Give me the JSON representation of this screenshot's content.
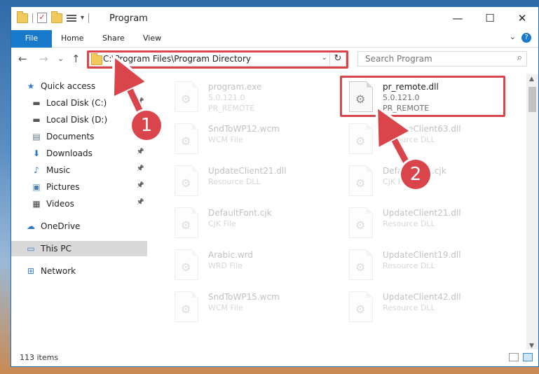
{
  "window": {
    "title": "Program",
    "controls": {
      "minimize": "—",
      "maximize": "☐",
      "close": "✕"
    }
  },
  "ribbon": {
    "tabs": [
      "File",
      "Home",
      "Share",
      "View"
    ],
    "help": "?"
  },
  "navigation": {
    "back": "←",
    "forward": "→",
    "recent": "⌄",
    "up": "↑",
    "address": "C:\\Program Files\\Program Directory",
    "refresh": "↻",
    "search_placeholder": "Search Program"
  },
  "sidebar": {
    "items": [
      {
        "label": "Quick access",
        "icon": "star-icon",
        "glyph": "★",
        "color": "#3a7bd5",
        "pinned": false
      },
      {
        "label": "Local Disk (C:)",
        "icon": "drive-icon",
        "glyph": "▬",
        "color": "#555555",
        "pinned": true
      },
      {
        "label": "Local Disk (D:)",
        "icon": "drive-icon",
        "glyph": "▬",
        "color": "#555555",
        "pinned": true
      },
      {
        "label": "Documents",
        "icon": "documents-icon",
        "glyph": "▤",
        "color": "#5a6f88",
        "pinned": true
      },
      {
        "label": "Downloads",
        "icon": "download-icon",
        "glyph": "⬇",
        "color": "#2c76c9",
        "pinned": true
      },
      {
        "label": "Music",
        "icon": "music-icon",
        "glyph": "♪",
        "color": "#2c76c9",
        "pinned": true
      },
      {
        "label": "Pictures",
        "icon": "pictures-icon",
        "glyph": "▣",
        "color": "#4a7fb8",
        "pinned": true
      },
      {
        "label": "Videos",
        "icon": "video-icon",
        "glyph": "▦",
        "color": "#444444",
        "pinned": true
      },
      {
        "label": "OneDrive",
        "icon": "cloud-icon",
        "glyph": "☁",
        "color": "#2c76c9",
        "pinned": false
      },
      {
        "label": "This PC",
        "icon": "computer-icon",
        "glyph": "▭",
        "color": "#3a7bd5",
        "pinned": false,
        "selected": true
      },
      {
        "label": "Network",
        "icon": "network-icon",
        "glyph": "⊞",
        "color": "#3a7bd5",
        "pinned": false
      }
    ]
  },
  "files": [
    {
      "name": "program.exe",
      "line1": "5.0.121.0",
      "line2": "PR_REMOTE",
      "faded": true,
      "col": 0,
      "row": 0
    },
    {
      "name": "pr_remote.dll",
      "line1": "5.0.121.0",
      "line2": "PR_REMOTE",
      "faded": false,
      "col": 1,
      "row": 0
    },
    {
      "name": "SndToWP12.wcm",
      "line1": "WCM File",
      "line2": "",
      "faded": true,
      "col": 0,
      "row": 1
    },
    {
      "name": "UpdateClient63.dll",
      "line1": "Resource DLL",
      "line2": "",
      "faded": true,
      "col": 1,
      "row": 1
    },
    {
      "name": "UpdateClient21.dll",
      "line1": "Resource DLL",
      "line2": "",
      "faded": true,
      "col": 0,
      "row": 2
    },
    {
      "name": "DefaultFont.cjk",
      "line1": "CJK File",
      "line2": "",
      "faded": true,
      "col": 1,
      "row": 2
    },
    {
      "name": "DefaultFont.cjk",
      "line1": "CJK File",
      "line2": "",
      "faded": true,
      "col": 0,
      "row": 3
    },
    {
      "name": "UpdateClient21.dll",
      "line1": "Resource DLL",
      "line2": "",
      "faded": true,
      "col": 1,
      "row": 3
    },
    {
      "name": "Arabic.wrd",
      "line1": "WRD File",
      "line2": "",
      "faded": true,
      "col": 0,
      "row": 4
    },
    {
      "name": "UpdateClient19.dll",
      "line1": "Resource DLL",
      "line2": "",
      "faded": true,
      "col": 1,
      "row": 4
    },
    {
      "name": "SndToWP15.wcm",
      "line1": "WCM File",
      "line2": "",
      "faded": true,
      "col": 0,
      "row": 5
    },
    {
      "name": "UpdateClient42.dll",
      "line1": "Resource DLL",
      "line2": "",
      "faded": true,
      "col": 1,
      "row": 5
    }
  ],
  "status": {
    "item_count": "113 items"
  },
  "annotations": {
    "step1": "1",
    "step2": "2",
    "highlight_color": "#d9454b"
  }
}
